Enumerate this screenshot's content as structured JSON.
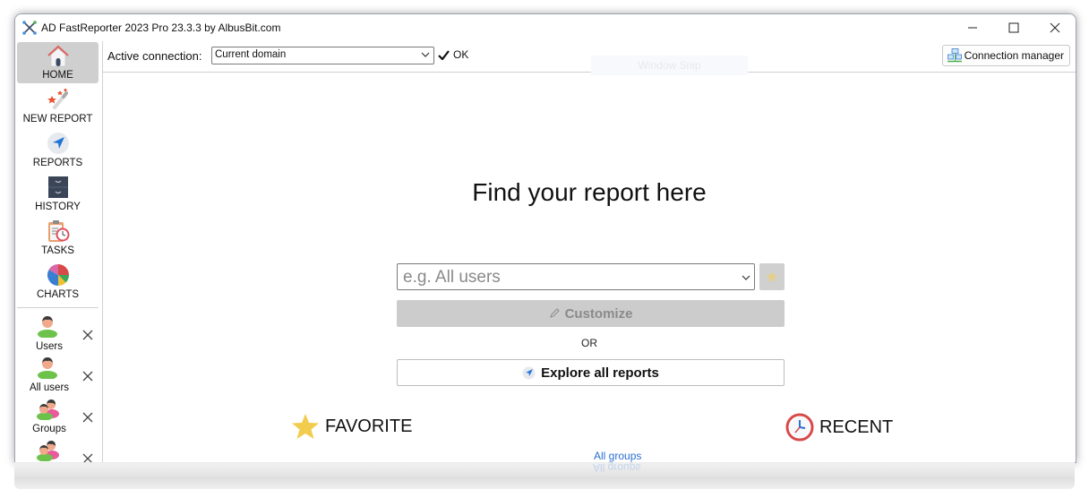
{
  "window": {
    "title": "AD FastReporter 2023 Pro 23.3.3 by AlbusBit.com",
    "controls": {
      "minimize": "—",
      "maximize": "☐",
      "close": "✕"
    }
  },
  "sidebar": {
    "nav": [
      {
        "label": "HOME",
        "icon": "home-icon",
        "active": true
      },
      {
        "label": "NEW REPORT",
        "icon": "magic-wand-icon",
        "active": false
      },
      {
        "label": "REPORTS",
        "icon": "navigation-arrow-icon",
        "active": false
      },
      {
        "label": "HISTORY",
        "icon": "file-cabinet-icon",
        "active": false
      },
      {
        "label": "TASKS",
        "icon": "clipboard-clock-icon",
        "active": false
      },
      {
        "label": "CHARTS",
        "icon": "pie-chart-icon",
        "active": false
      }
    ],
    "open_tabs": [
      {
        "label": "Users",
        "icon": "user-icon"
      },
      {
        "label": "All users",
        "icon": "user-icon"
      },
      {
        "label": "Groups",
        "icon": "group-icon"
      },
      {
        "label": "",
        "icon": "group-icon"
      }
    ]
  },
  "toolbar": {
    "connection_label": "Active connection:",
    "connection_value": "Current domain",
    "status": "OK",
    "overlay_text": "Window Snip",
    "connection_manager": "Connection manager"
  },
  "main": {
    "headline": "Find your report here",
    "search_placeholder": "e.g. All users",
    "customize_label": "Customize",
    "or_label": "OR",
    "explore_label": "Explore all reports",
    "favorite_label": "FAVORITE",
    "recent_label": "RECENT",
    "all_groups_link": "All groups"
  },
  "colors": {
    "accent_link": "#2a6fd1",
    "favorite_star": "#f2cc4d",
    "active_nav_bg": "#cfcfcf",
    "disabled_button_bg": "#cccccc"
  }
}
